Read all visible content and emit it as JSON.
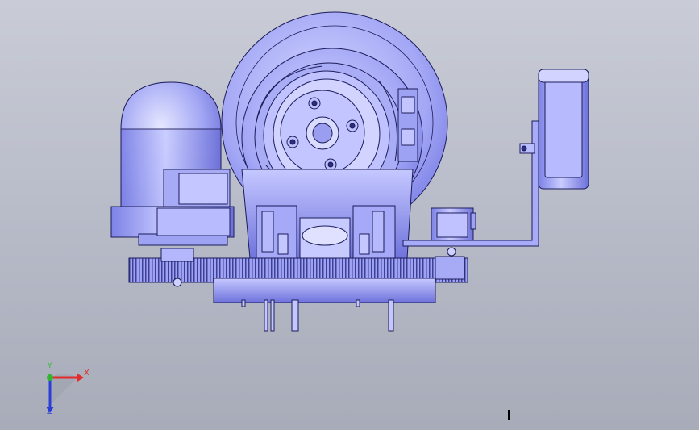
{
  "viewport": {
    "background_top": "#c9ccd6",
    "background_bottom": "#a8acb9",
    "model_color": "#8f93f0",
    "model_edge": "#1c1c5a"
  },
  "triad": {
    "x_label": "X",
    "y_label": "Y",
    "z_label": "Z",
    "x_color": "#e32b2b",
    "y_color": "#2fb52f",
    "z_color": "#2a3dd8"
  }
}
